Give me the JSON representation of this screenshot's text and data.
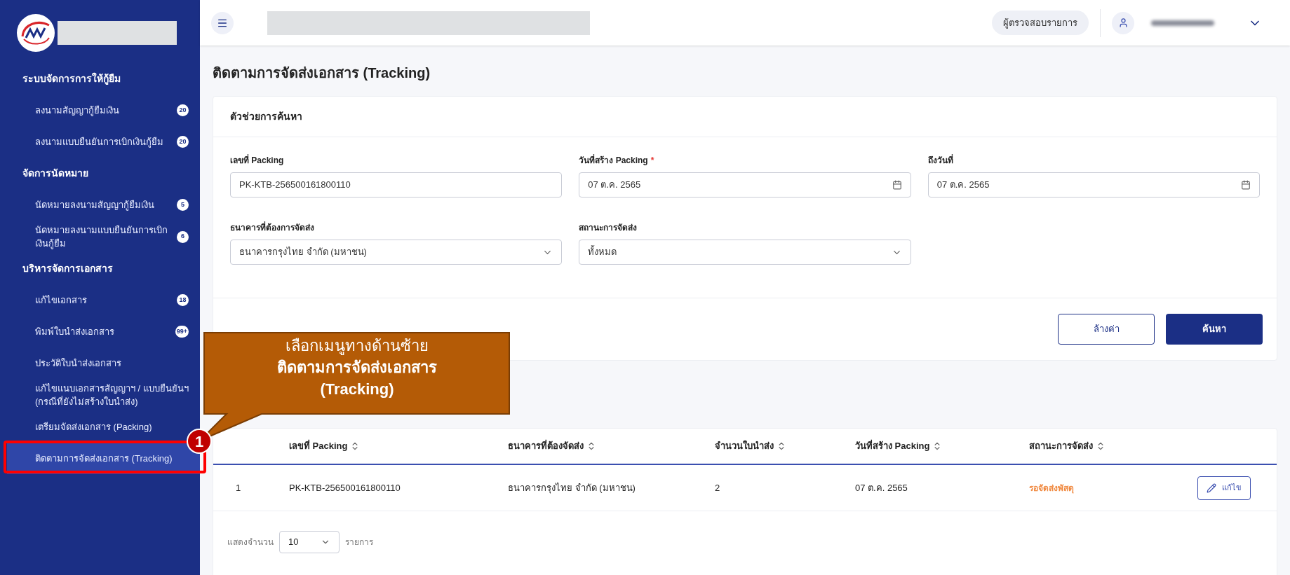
{
  "sidebar": {
    "sections": [
      {
        "title": "ระบบจัดการการให้กู้ยืม",
        "items": [
          {
            "label": "ลงนามสัญญากู้ยืมเงิน",
            "badge": "20",
            "selected": false
          },
          {
            "label": "ลงนามแบบยืนยันการเบิกเงินกู้ยืม",
            "badge": "20",
            "selected": false
          }
        ]
      },
      {
        "title": "จัดการนัดหมาย",
        "items": [
          {
            "label": "นัดหมายลงนามสัญญากู้ยืมเงิน",
            "badge": "5",
            "selected": false
          },
          {
            "label": "นัดหมายลงนามแบบยืนยันการเบิกเงินกู้ยืม",
            "badge": "6",
            "selected": false
          }
        ]
      },
      {
        "title": "บริหารจัดการเอกสาร",
        "items": [
          {
            "label": "แก้ไขเอกสาร",
            "badge": "18",
            "selected": false
          },
          {
            "label": "พิมพ์ใบนำส่งเอกสาร",
            "badge": "99+",
            "selected": false
          },
          {
            "label": "ประวัติใบนำส่งเอกสาร",
            "selected": false
          },
          {
            "label": "แก้ไขแนบเอกสารสัญญาฯ / แบบยืนยันฯ (กรณีที่ยังไม่สร้างใบนำส่ง)",
            "selected": false
          },
          {
            "label": "เตรียมจัดส่งเอกสาร (Packing)",
            "selected": false
          },
          {
            "label": "ติดตามการจัดส่งเอกสาร (Tracking)",
            "selected": true
          }
        ]
      }
    ]
  },
  "header": {
    "role": "ผู้ตรวจสอบรายการ"
  },
  "page_title": "ติดตามการจัดส่งเอกสาร (Tracking)",
  "search": {
    "title": "ตัวช่วยการค้นหา",
    "fields": [
      {
        "kind": "text",
        "label": "เลขที่ Packing",
        "value": "PK-KTB-256500161800110"
      },
      {
        "kind": "date",
        "label": "วันที่สร้าง Packing",
        "required_mark": "*",
        "value": "07 ต.ค. 2565"
      },
      {
        "kind": "date",
        "label": "ถึงวันที่",
        "value": "07 ต.ค. 2565"
      },
      {
        "kind": "select",
        "label": "ธนาคารที่ต้องการจัดส่ง",
        "value": "ธนาคารกรุงไทย จำกัด (มหาชน)"
      },
      {
        "kind": "select",
        "label": "สถานะการจัดส่ง",
        "value": "ทั้งหมด"
      }
    ],
    "buttons": [
      {
        "label": "ล้างค่า",
        "kind": "outline"
      },
      {
        "label": "ค้นหา",
        "kind": "primary"
      }
    ]
  },
  "table": {
    "columns": [
      "",
      "เลขที่ Packing",
      "ธนาคารที่ต้องจัดส่ง",
      "จำนวนใบนำส่ง",
      "วันที่สร้าง Packing",
      "สถานะการจัดส่ง"
    ],
    "rows": [
      {
        "cells": [
          "1",
          "PK-KTB-256500161800110",
          "ธนาคารกรุงไทย จำกัด (มหาชน)",
          "2",
          "07 ต.ค. 2565",
          "รอจัดส่งพัสดุ"
        ],
        "color": "#f0883e",
        "action": "แก้ไข"
      }
    ],
    "pagination": {
      "prefix": "แสดงจำนวน",
      "page_size": "10",
      "suffix": "รายการ"
    }
  },
  "callout": {
    "step": "1",
    "lines": [
      {
        "text": "เลือกเมนูทางด้านซ้าย",
        "bold": false
      },
      {
        "text": "ติดตามการจัดส่งเอกสาร",
        "bold": true
      },
      {
        "text": "(Tracking)",
        "bold": true
      }
    ]
  }
}
